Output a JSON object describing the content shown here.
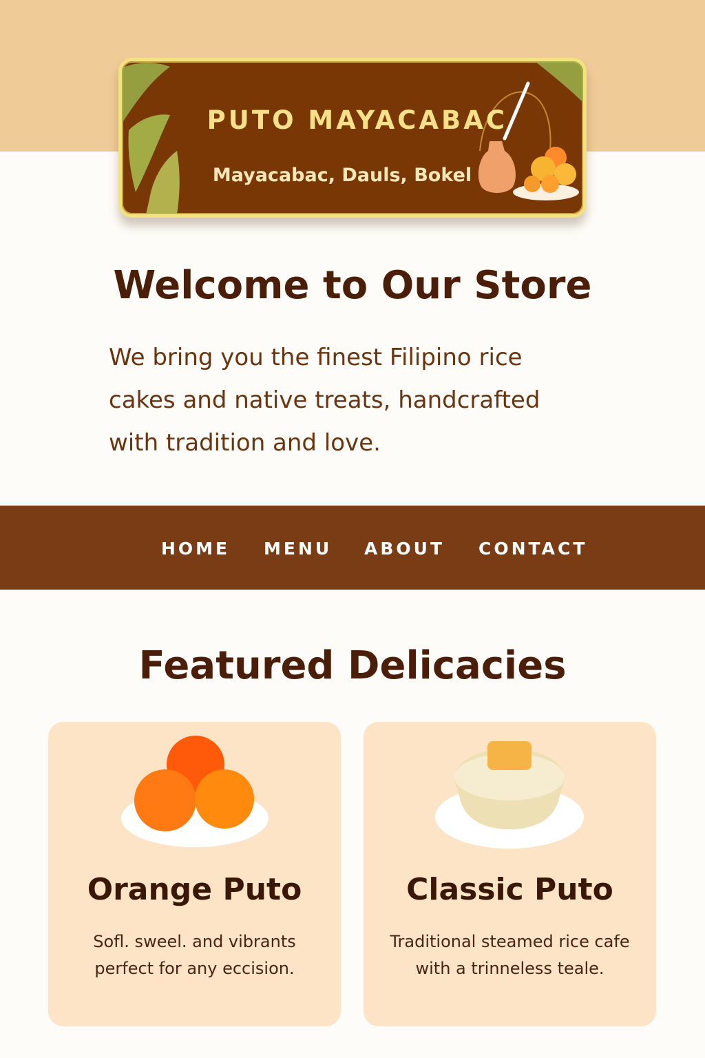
{
  "brand": {
    "name": "PUTO MAYACABAC",
    "location": "Mayacabac, Dauls, Bokel"
  },
  "hero": {
    "title": "Welcome to Our Store",
    "intro": "We bring you the finest Filipino rice cakes and native treats, handcrafted with tradition and love."
  },
  "nav": {
    "items": [
      {
        "label": "HOME"
      },
      {
        "label": "MENU"
      },
      {
        "label": "ABOUT"
      },
      {
        "label": "CONTACT"
      }
    ]
  },
  "featured": {
    "title": "Featured Delicacies",
    "products": [
      {
        "name": "Orange Puto",
        "description": "Sofl. sweel. and vibrants perfect for any eccision.",
        "image_icon": "orange-puto-icon"
      },
      {
        "name": "Classic Puto",
        "description": "Traditional steamed rice cafe with a trinneless teale.",
        "image_icon": "classic-puto-icon"
      }
    ]
  },
  "colors": {
    "top_band": "#efcb98",
    "logo_background": "#7a3706",
    "logo_border": "#f4e27e",
    "nav_background": "#7a3c14",
    "heading": "#4a1e08",
    "body_text": "#6b3410",
    "card_background": "#fde4c6",
    "page_background": "#fefcf8"
  }
}
